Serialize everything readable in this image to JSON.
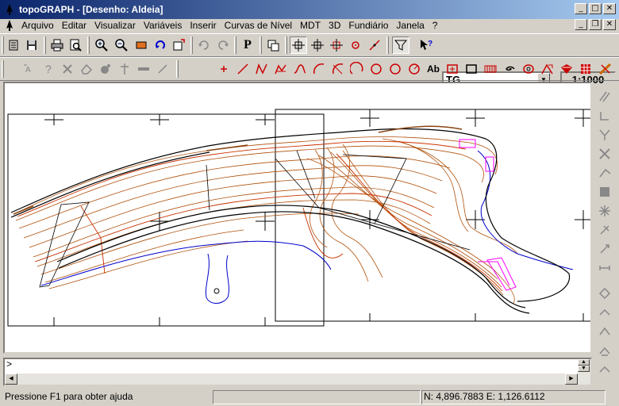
{
  "window": {
    "title": "topoGRAPH - [Desenho: Aldeia]",
    "minimize_glyph": "_",
    "maximize_glyph": "□",
    "close_glyph": "✕",
    "restore_glyph": "❐"
  },
  "menu": [
    "Arquivo",
    "Editar",
    "Visualizar",
    "Variáveis",
    "Inserir",
    "Curvas de Nível",
    "MDT",
    "3D",
    "Fundiário",
    "Janela",
    "?"
  ],
  "toolbar": {
    "layer_value": "TG",
    "scale_value": "1:1000",
    "text_tool_label": "Ab",
    "properties_label": "P"
  },
  "command": {
    "prompt": ">"
  },
  "status": {
    "help_text": "Pressione F1 para obter ajuda",
    "coords": "N: 4,896.7883 E: 1,126.6112"
  },
  "colors": {
    "contour_brown": "#8b4513",
    "contour_red": "#c83200",
    "water_blue": "#0000cc",
    "magenta": "#ff00ff",
    "toolbar_red": "#cc0000",
    "titlebar": "#0a246a"
  },
  "icons": {
    "toolbar1": [
      "list-icon",
      "save-icon",
      "print-icon",
      "print-preview-icon",
      "zoom-in-icon",
      "zoom-out-icon",
      "zoom-window-icon",
      "zoom-previous-icon",
      "zoom-extents-icon",
      "undo-icon",
      "redo-icon",
      "properties-icon",
      "copy-window-icon",
      "snap-endpoint-icon",
      "snap-intersection-icon",
      "snap-midpoint-icon",
      "snap-center-icon",
      "snap-perpendicular-icon",
      "filter-icon",
      "help-pointer-icon"
    ],
    "toolbar2": [
      "attribute-icon",
      "question-icon",
      "delete-icon",
      "erase-icon",
      "settings-icon",
      "anchor-icon",
      "rectangle-tool-icon",
      "pen-icon",
      "point-icon",
      "line-icon",
      "polyline-icon",
      "spline-icon",
      "curve-icon",
      "arc-icon",
      "arc-3pt-icon",
      "arc-ccw-icon",
      "arc-cw-icon",
      "circle-icon",
      "circle-2pt-icon",
      "circle-radius-icon",
      "text-icon",
      "symbol-icon",
      "rectangle-icon",
      "hatch-icon",
      "spiral-icon",
      "ellipse-icon",
      "polygon-icon",
      "block-icon",
      "grid-icon",
      "ruler-icon"
    ]
  }
}
